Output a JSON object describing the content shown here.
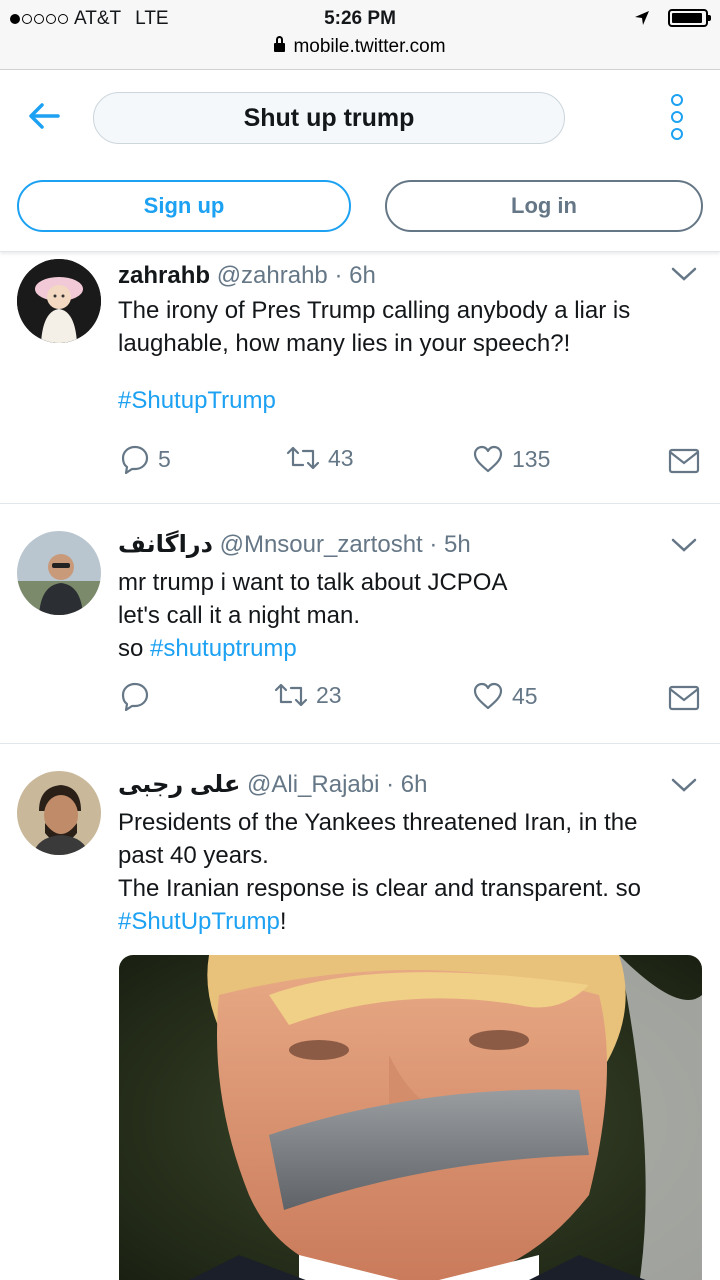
{
  "status_bar": {
    "carrier": "AT&T",
    "network": "LTE",
    "time": "5:26 PM",
    "url": "mobile.twitter.com",
    "battery_level": 0.95
  },
  "header": {
    "search_query": "Shut up trump",
    "signup_label": "Sign up",
    "login_label": "Log in"
  },
  "colors": {
    "accent": "#1da1f2",
    "text_primary": "#14171a",
    "text_secondary": "#657786"
  },
  "tweets": [
    {
      "name": "zahrahb",
      "handle": "@zahrahb",
      "time": "· 6h",
      "text_lines": [
        "The irony of Pres Trump calling anybody a liar is",
        "laughable, how many lies in your speech?!"
      ],
      "hashtag": "#ShutupTrump",
      "replies": "5",
      "retweets": "43",
      "likes": "135"
    },
    {
      "name": "دراگانف",
      "handle": "@Mnsour_zartosht",
      "time": "· 5h",
      "text_lines": [
        "mr trump i want to talk about JCPOA",
        "let's call it a night man."
      ],
      "text_prefix": "so ",
      "hashtag": "#shutuptrump",
      "replies": "",
      "retweets": "23",
      "likes": "45"
    },
    {
      "name": "علی رجبی",
      "handle": "@Ali_Rajabi",
      "time": "· 6h",
      "text_lines": [
        "Presidents of the Yankees threatened Iran, in the",
        "past 40 years.",
        "The Iranian response is clear and transparent. so"
      ],
      "hashtag": "#ShutUpTrump",
      "text_suffix": "!"
    }
  ]
}
